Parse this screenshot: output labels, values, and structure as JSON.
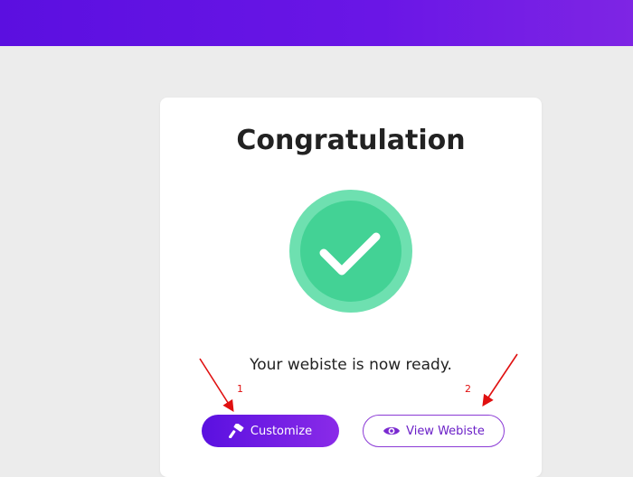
{
  "header": {
    "gradient_start": "#5b0fe0",
    "gradient_end": "#7e25e4"
  },
  "card": {
    "title": "Congratulation",
    "status_icon": "check-circle-icon",
    "message": "Your webiste is now ready."
  },
  "buttons": {
    "customize_label": "Customize",
    "customize_icon": "hammer-icon",
    "view_label": "View Webiste",
    "view_icon": "eye-icon"
  },
  "annotations": {
    "marker_1": "1",
    "marker_2": "2",
    "color": "#e01010"
  },
  "colors": {
    "check_outer": "#6ee0b0",
    "check_inner": "#43d295",
    "accent": "#6a1fc7"
  }
}
